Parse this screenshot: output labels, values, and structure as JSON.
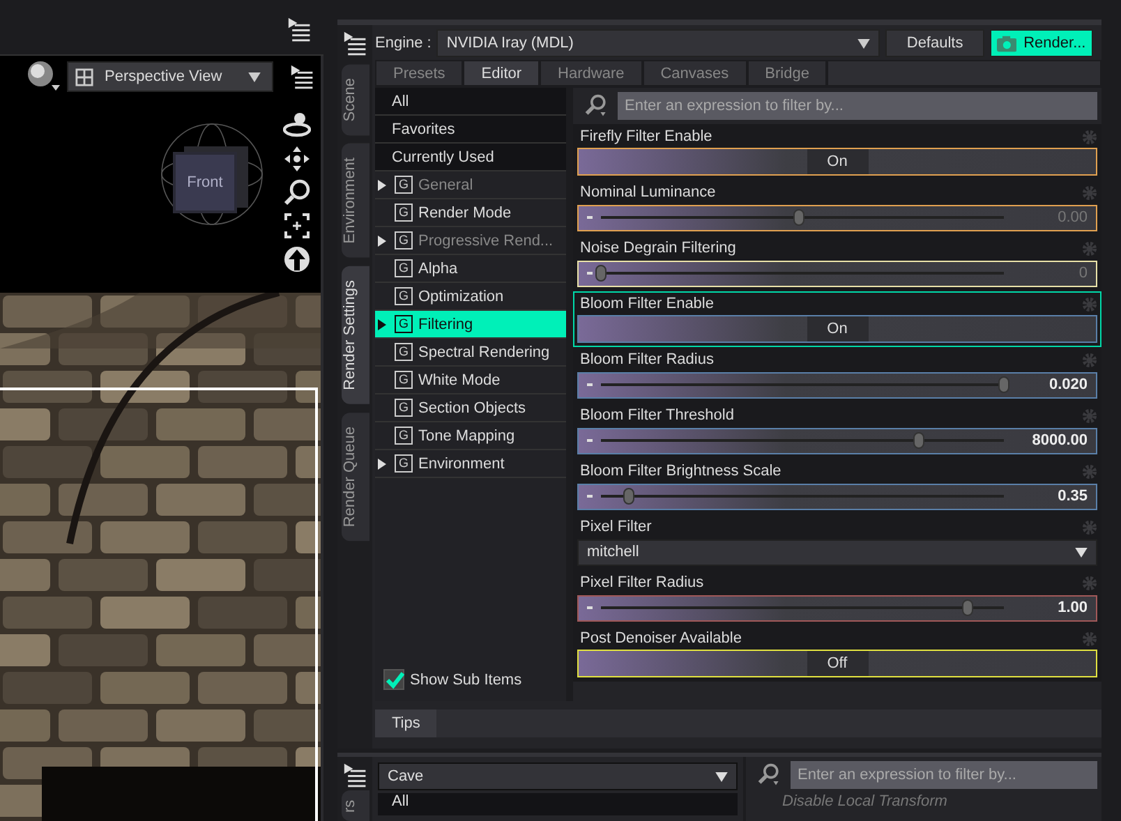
{
  "viewport": {
    "view_menu": "Perspective View",
    "cube_label": "Front"
  },
  "side_tabs": [
    {
      "label": "Scene",
      "selected": false
    },
    {
      "label": "Environment",
      "selected": false
    },
    {
      "label": "Render Settings",
      "selected": true
    },
    {
      "label": "Render Queue",
      "selected": false
    }
  ],
  "render": {
    "engine_label": "Engine :",
    "engine": "NVIDIA Iray (MDL)",
    "buttons": [
      {
        "label": "Defaults",
        "kind": "plain"
      },
      {
        "label": "Render...",
        "kind": "primary"
      }
    ]
  },
  "tabs": [
    {
      "label": "Presets",
      "selected": false
    },
    {
      "label": "Editor",
      "selected": true
    },
    {
      "label": "Hardware",
      "selected": false
    },
    {
      "label": "Canvases",
      "selected": false
    },
    {
      "label": "Bridge",
      "selected": false
    }
  ],
  "groups": [
    {
      "label": "All",
      "kind": "filter",
      "selected": false
    },
    {
      "label": "Favorites",
      "kind": "filter",
      "selected": false
    },
    {
      "label": "Currently Used",
      "kind": "filter",
      "selected": false
    },
    {
      "label": "General",
      "kind": "group",
      "icon_letter": "G",
      "expandable": true,
      "disabled": true,
      "selected": false
    },
    {
      "label": "Render Mode",
      "kind": "group",
      "icon_letter": "G",
      "expandable": false,
      "disabled": false,
      "selected": false
    },
    {
      "label": "Progressive Rend...",
      "kind": "group",
      "icon_letter": "G",
      "expandable": true,
      "disabled": true,
      "selected": false
    },
    {
      "label": "Alpha",
      "kind": "group",
      "icon_letter": "G",
      "expandable": false,
      "disabled": false,
      "selected": false
    },
    {
      "label": "Optimization",
      "kind": "group",
      "icon_letter": "G",
      "expandable": false,
      "disabled": false,
      "selected": false
    },
    {
      "label": "Filtering",
      "kind": "group",
      "icon_letter": "G",
      "expandable": true,
      "disabled": false,
      "selected": true
    },
    {
      "label": "Spectral Rendering",
      "kind": "group",
      "icon_letter": "G",
      "expandable": false,
      "disabled": false,
      "selected": false
    },
    {
      "label": "White Mode",
      "kind": "group",
      "icon_letter": "G",
      "expandable": false,
      "disabled": false,
      "selected": false
    },
    {
      "label": "Section Objects",
      "kind": "group",
      "icon_letter": "G",
      "expandable": false,
      "disabled": false,
      "selected": false
    },
    {
      "label": "Tone Mapping",
      "kind": "group",
      "icon_letter": "G",
      "expandable": false,
      "disabled": false,
      "selected": false
    },
    {
      "label": "Environment",
      "kind": "group",
      "icon_letter": "G",
      "expandable": true,
      "disabled": false,
      "selected": false
    }
  ],
  "show_sub_items": {
    "label": "Show Sub Items",
    "checked": true
  },
  "filter": {
    "placeholder": "Enter an expression to filter by..."
  },
  "properties": [
    {
      "label": "Firefly Filter Enable",
      "kind": "toggle",
      "value": "On",
      "color": "#e0a050",
      "selected": false
    },
    {
      "label": "Nominal Luminance",
      "kind": "slider",
      "level": 0.49,
      "value": "0.00",
      "at_default": true,
      "color": "#e0a050",
      "selected": false
    },
    {
      "label": "Noise Degrain Filtering",
      "kind": "slider",
      "level": 0.0,
      "value": "0",
      "at_default": true,
      "color": "#e8e0a8",
      "selected": false
    },
    {
      "label": "Bloom Filter Enable",
      "kind": "toggle",
      "value": "On",
      "color": "#5a7fa8",
      "selected": true
    },
    {
      "label": "Bloom Filter Radius",
      "kind": "slider",
      "level": 1.0,
      "value": "0.020",
      "at_default": false,
      "color": "#5a7fa8",
      "selected": false
    },
    {
      "label": "Bloom Filter Threshold",
      "kind": "slider",
      "level": 0.79,
      "value": "8000.00",
      "at_default": false,
      "color": "#5a7fa8",
      "selected": false
    },
    {
      "label": "Bloom Filter Brightness Scale",
      "kind": "slider",
      "level": 0.07,
      "value": "0.35",
      "at_default": false,
      "color": "#5a7fa8",
      "selected": false
    },
    {
      "label": "Pixel Filter",
      "kind": "dropdown",
      "value": "mitchell",
      "selected": false
    },
    {
      "label": "Pixel Filter Radius",
      "kind": "slider",
      "level": 0.91,
      "value": "1.00",
      "at_default": false,
      "color": "#a05858",
      "selected": false
    },
    {
      "label": "Post Denoiser Available",
      "kind": "toggle",
      "value": "Off",
      "color": "#e0e040",
      "selected": false
    }
  ],
  "tips_tab": "Tips",
  "bottom": {
    "side_tab": "rs",
    "preset": "Cave",
    "items": [
      "All"
    ],
    "filter_placeholder": "Enter an expression to filter by...",
    "property": "Disable Local Transform"
  }
}
